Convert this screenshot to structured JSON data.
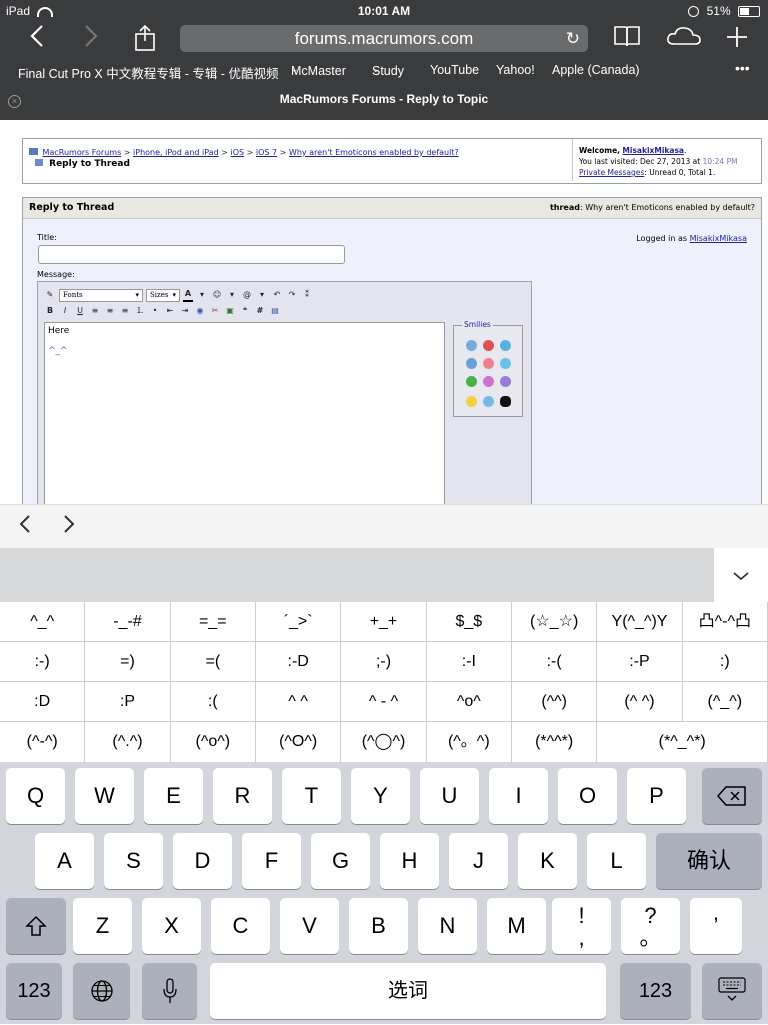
{
  "status": {
    "device": "iPad",
    "time": "10:01 AM",
    "battery": "51%"
  },
  "browser": {
    "url": "forums.macrumors.com",
    "bookmarks": [
      "Final Cut Pro X 中文教程专辑 - 专辑 - 优酷视频",
      "McMaster",
      "Study",
      "YouTube",
      "Yahoo!",
      "Apple (Canada)"
    ],
    "more": "•••",
    "tab_title": "MacRumors Forums - Reply to Topic"
  },
  "forum": {
    "breadcrumb": [
      "MacRumors Forums",
      "iPhone, iPod and iPad",
      "iOS",
      "iOS 7",
      "Why aren't Emoticons enabled by default?"
    ],
    "thread_title": "Reply to Thread",
    "welcome_prefix": "Welcome,",
    "username": "MisakixMikasa",
    "last_visited": "You last visited: Dec 27, 2013 at",
    "last_visited_time": "10:24 PM",
    "pm_link": "Private Messages",
    "pm_status": ": Unread 0, Total 1.",
    "panel_title": "Reply to Thread",
    "thread_label": "thread",
    "thread_name": ": Why aren't Emoticons enabled by default?",
    "title_label": "Title:",
    "logged_in_label": "Logged in as",
    "message_label": "Message:",
    "font_select": "Fonts",
    "size_select": "Sizes",
    "message_line1": "Here",
    "message_line2": "^_^",
    "smilies_label": "Smilies"
  },
  "accessory": {
    "prev": "‹",
    "next": "›",
    "hide": "⌄"
  },
  "kaomoji": [
    [
      "^_^",
      "-_-#",
      "=_=",
      "´_>`",
      "+_+",
      "$_$",
      "(☆_☆)",
      "Y(^_^)Y",
      "凸^-^凸"
    ],
    [
      ":-)",
      "=)",
      "=(",
      ":-D",
      ";-)",
      ":-I",
      ":-(",
      ":-P",
      ":)"
    ],
    [
      ":D",
      ":P",
      ":(",
      "^ ^",
      "^ - ^",
      "^o^",
      "(^^)",
      "(^ ^)",
      "(^_^)"
    ],
    [
      "(^-^)",
      "(^.^)",
      "(^o^)",
      "(^O^)",
      "(^◯^)",
      "(^。^)",
      "(*^^*)",
      "(*^_^*)"
    ]
  ],
  "keyboard": {
    "row1": [
      "Q",
      "W",
      "E",
      "R",
      "T",
      "Y",
      "U",
      "I",
      "O",
      "P"
    ],
    "row2": [
      "A",
      "S",
      "D",
      "F",
      "G",
      "H",
      "J",
      "K",
      "L"
    ],
    "confirm": "确认",
    "row3": [
      "Z",
      "X",
      "C",
      "V",
      "B",
      "N",
      "M"
    ],
    "exclaim_top": "!",
    "exclaim_bottom": ",",
    "question_top": "?",
    "question_bottom": "。",
    "apostrophe": "’",
    "numbers": "123",
    "space": "选词"
  }
}
